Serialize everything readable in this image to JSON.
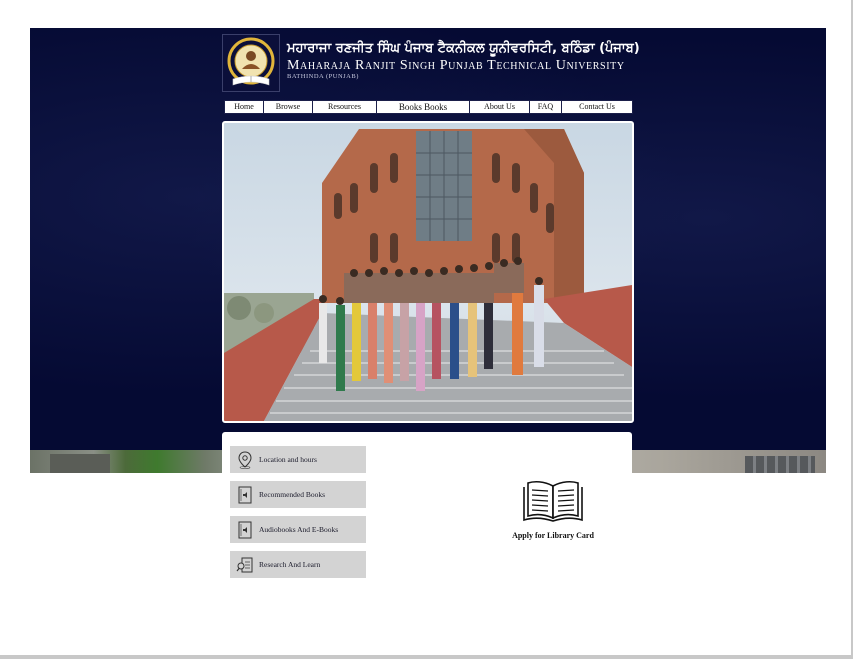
{
  "header": {
    "univ_name_punjabi": "ਮਹਾਰਾਜਾ ਰਣਜੀਤ ਸਿੰਘ ਪੰਜਾਬ ਟੈਕਨੀਕਲ ਯੂਨੀਵਰਸਿਟੀ, ਬਠਿੰਡਾ (ਪੰਜਾਬ)",
    "univ_name_english": "Maharaja Ranjit Singh Punjab Technical University",
    "univ_city": "BATHINDA (PUNJAB)",
    "logo_icon": "university-seal-icon"
  },
  "nav": {
    "items": [
      {
        "label": "Home"
      },
      {
        "label": "Browse"
      },
      {
        "label": "Resources"
      },
      {
        "label": "Books Books"
      },
      {
        "label": "About Us"
      },
      {
        "label": "FAQ"
      },
      {
        "label": "Contact Us"
      }
    ]
  },
  "sidebar": {
    "items": [
      {
        "label": "Location and hours",
        "icon": "map-pin-icon"
      },
      {
        "label": "Recommended Books",
        "icon": "audio-book-icon"
      },
      {
        "label": "Audiobooks And E-Books",
        "icon": "audio-book-icon"
      },
      {
        "label": "Research And Learn",
        "icon": "search-document-icon"
      }
    ]
  },
  "library_card": {
    "label": "Apply for Library Card",
    "icon": "open-book-icon"
  },
  "colors": {
    "hero_background": "#050a33",
    "sidebar_button": "#d3d3d3",
    "building_brick": "#b4694a"
  }
}
